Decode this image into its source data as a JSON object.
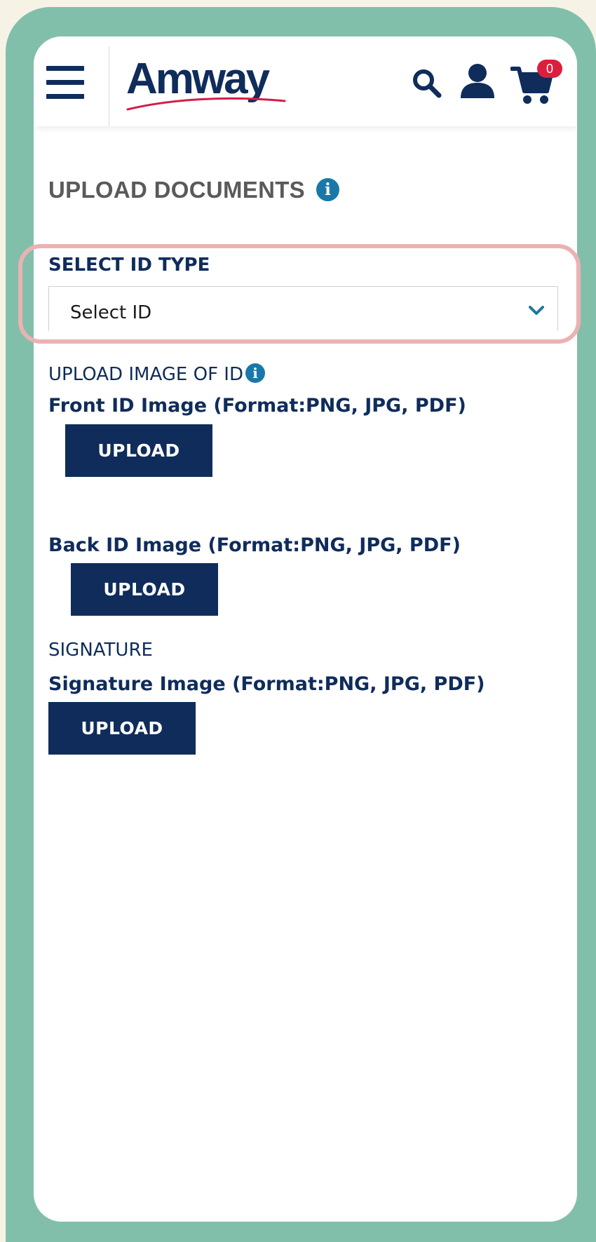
{
  "header": {
    "logo_text": "Amway",
    "cart_count": "0",
    "colors": {
      "brand_navy": "#0f2c5b",
      "badge_red": "#dc1e3c",
      "logo_swoosh": "#d21e46"
    },
    "icons": [
      "menu-icon",
      "search-icon",
      "user-icon",
      "cart-icon"
    ]
  },
  "page": {
    "title": "UPLOAD DOCUMENTS",
    "info_glyph": "i"
  },
  "id_type": {
    "label": "SELECT ID TYPE",
    "selected": "Select ID"
  },
  "upload_id": {
    "label": "UPLOAD IMAGE OF ID",
    "front_label": "Front ID Image (Format:PNG, JPG, PDF)",
    "front_button": "UPLOAD",
    "back_label": "Back ID Image (Format:PNG, JPG, PDF)",
    "back_button": "UPLOAD"
  },
  "signature": {
    "label": "SIGNATURE",
    "image_label": "Signature Image (Format:PNG, JPG, PDF)",
    "button": "UPLOAD"
  }
}
